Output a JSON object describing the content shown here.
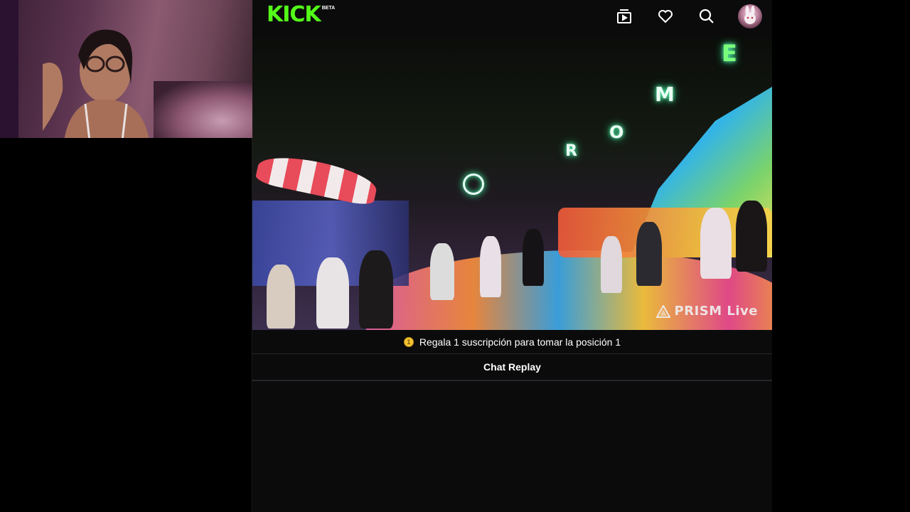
{
  "header": {
    "logo_text": "KICK",
    "logo_badge": "BETA",
    "icons": [
      "clips-icon",
      "heart-icon",
      "search-icon",
      "avatar"
    ]
  },
  "video": {
    "watermark": "PRISM Live",
    "neon_letters": [
      "R",
      "O",
      "M",
      "E"
    ]
  },
  "subscription_banner": {
    "badge": "1",
    "text": "Regala 1 suscripción para tomar la posición 1"
  },
  "chat": {
    "title": "Chat Replay"
  },
  "colors": {
    "brand": "#53fc18",
    "background": "#0b0b0c",
    "divider": "#26272b",
    "coin": "#f3c235"
  }
}
